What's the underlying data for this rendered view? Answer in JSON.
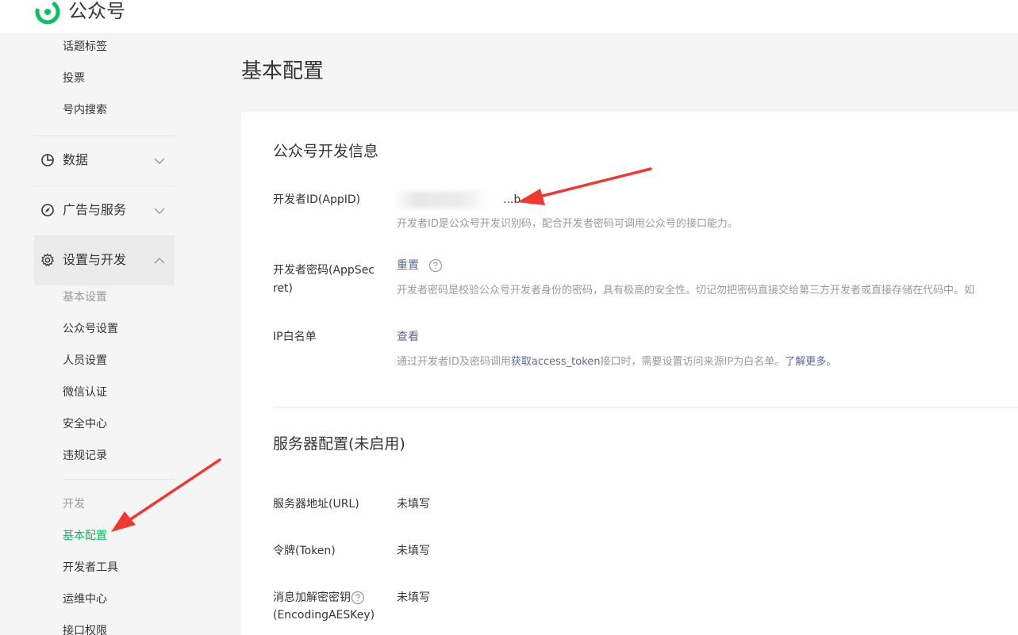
{
  "header": {
    "brand": "公众号"
  },
  "sidebar": {
    "top_items": [
      "话题标签",
      "投票",
      "号内搜索"
    ],
    "groups": [
      {
        "label": "数据",
        "icon": "pie-chart-icon",
        "expanded": false
      },
      {
        "label": "广告与服务",
        "icon": "compass-icon",
        "expanded": false
      },
      {
        "label": "设置与开发",
        "icon": "gear-icon",
        "expanded": true
      }
    ],
    "settings_items": [
      "基本设置",
      "公众号设置",
      "人员设置",
      "微信认证",
      "安全中心",
      "违规记录"
    ],
    "dev_items": [
      "开发",
      "基本配置",
      "开发者工具",
      "运维中心",
      "接口权限"
    ]
  },
  "main": {
    "page_title": "基本配置",
    "dev_info": {
      "title": "公众号开发信息",
      "appid_label": "开发者ID(AppID)",
      "appid_value": "...b",
      "appid_desc": "开发者ID是公众号开发识别码，配合开发者密码可调用公众号的接口能力。",
      "secret_label_1": "开发者密码(AppSec",
      "secret_label_2": "ret)",
      "secret_action": "重置",
      "secret_desc": "开发者密码是校验公众号开发者身份的密码，具有极高的安全性。切记勿把密码直接交给第三方开发者或直接存储在代码中。如",
      "ip_label": "IP白名单",
      "ip_action": "查看",
      "ip_desc_1": "通过开发者ID及密码调用",
      "ip_desc_link1": "获取access_token",
      "ip_desc_2": "接口时，需要设置访问来源IP为白名单。",
      "ip_desc_link2": "了解更多。"
    },
    "server": {
      "title": "服务器配置(未启用)",
      "url_label": "服务器地址(URL)",
      "url_value": "未填写",
      "token_label": "令牌(Token)",
      "token_value": "未填写",
      "aes_label_1": "消息加解密密钥",
      "aes_label_2": "(EncodingAESKey)",
      "aes_value": "未填写"
    }
  },
  "colors": {
    "accent_green": "#07c160",
    "link_blue": "#576b95",
    "arrow_red": "#f0382f"
  }
}
